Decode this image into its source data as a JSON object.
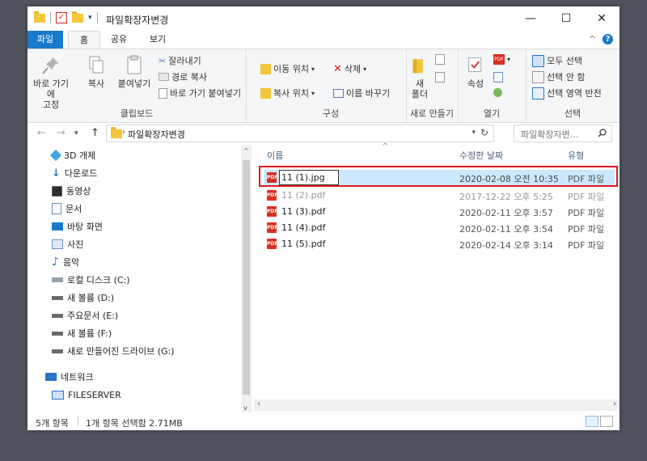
{
  "window": {
    "title": "파일확장자변경",
    "minimize_glyph": "—",
    "maximize_glyph": "☐",
    "close_glyph": "✕"
  },
  "tabs": {
    "file": "파일",
    "home": "홈",
    "share": "공유",
    "view": "보기",
    "collapse_glyph": "^",
    "help_glyph": "?"
  },
  "ribbon": {
    "clipboard": {
      "pin_label_1": "바로 가기에",
      "pin_label_2": "고정",
      "copy": "복사",
      "paste": "붙여넣기",
      "cut": "잘라내기",
      "copy_path": "경로 복사",
      "paste_shortcut": "바로 가기 붙여넣기",
      "group": "클립보드"
    },
    "organize": {
      "move_to": "이동 위치",
      "delete": "삭제",
      "copy_to": "복사 위치",
      "rename": "이름 바꾸기",
      "group": "구성"
    },
    "new": {
      "new_folder_1": "새",
      "new_folder_2": "폴더",
      "group": "새로 만들기"
    },
    "open": {
      "properties": "속성",
      "group": "열기"
    },
    "select": {
      "select_all": "모두 선택",
      "select_none": "선택 안 함",
      "invert": "선택 영역 반전",
      "group": "선택"
    }
  },
  "address": {
    "path": "파일확장자변경",
    "search_placeholder": "파일확장자변...",
    "back_glyph": "←",
    "forward_glyph": "→",
    "up_glyph": "↑"
  },
  "sidebar": {
    "items": [
      {
        "label": "3D 개체",
        "icon": "3d-objects-icon"
      },
      {
        "label": "다운로드",
        "icon": "downloads-icon"
      },
      {
        "label": "동영상",
        "icon": "videos-icon"
      },
      {
        "label": "문서",
        "icon": "documents-icon"
      },
      {
        "label": "바탕 화면",
        "icon": "desktop-icon"
      },
      {
        "label": "사진",
        "icon": "pictures-icon"
      },
      {
        "label": "음악",
        "icon": "music-icon"
      },
      {
        "label": "로컬 디스크 (C:)",
        "icon": "drive-icon"
      },
      {
        "label": "새 볼륨 (D:)",
        "icon": "drive-icon"
      },
      {
        "label": "주요문서 (E:)",
        "icon": "drive-icon"
      },
      {
        "label": "새 볼륨 (F:)",
        "icon": "drive-icon"
      },
      {
        "label": "새로 만들어진 드라이브 (G:)",
        "icon": "drive-icon"
      },
      {
        "label": "네트워크",
        "icon": "network-icon"
      },
      {
        "label": "FILESERVER",
        "icon": "computer-icon"
      }
    ]
  },
  "filelist": {
    "columns": {
      "name": "이름",
      "date": "수정한 날짜",
      "type": "유형"
    },
    "rows": [
      {
        "name": "11 (1).jpg",
        "date": "2020-02-08 오전 10:35",
        "type": "PDF 파일",
        "renaming": true
      },
      {
        "name": "11 (2).pdf",
        "date": "2017-12-22 오후 5:25",
        "type": "PDF 파일"
      },
      {
        "name": "11 (3).pdf",
        "date": "2020-02-11 오후 3:57",
        "type": "PDF 파일"
      },
      {
        "name": "11 (4).pdf",
        "date": "2020-02-11 오후 3:54",
        "type": "PDF 파일"
      },
      {
        "name": "11 (5).pdf",
        "date": "2020-02-14 오후 3:14",
        "type": "PDF 파일"
      }
    ]
  },
  "status": {
    "count": "5개 항목",
    "selected": "1개 항목 선택함 2.71MB"
  },
  "colors": {
    "accent": "#1979ca",
    "selection": "#cce8ff",
    "highlight_box": "#e0191e"
  }
}
